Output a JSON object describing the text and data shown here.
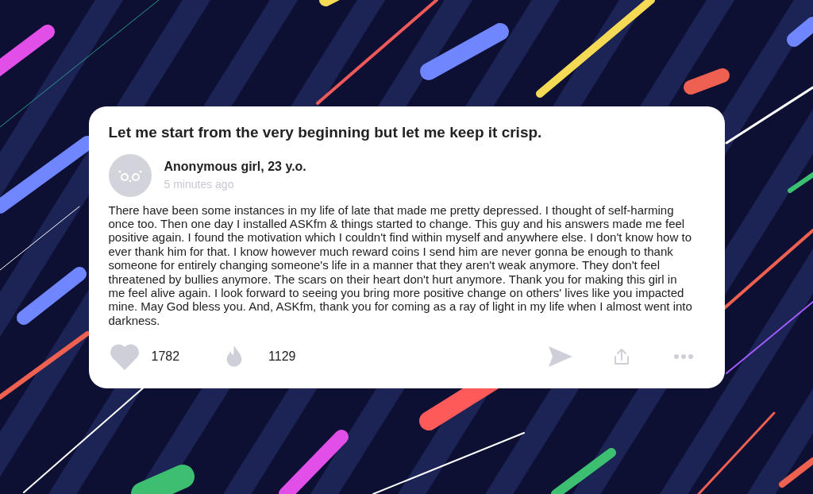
{
  "post": {
    "question": "Let me start from the very beginning but let me keep it crisp.",
    "author": "Anonymous girl, 23 y.o.",
    "time": "5 minutes ago",
    "answer": "There have been some instances in my life of late that made me pretty depressed. I thought of self-harming once too. Then one day I installed ASKfm & things started to change. This guy and his answers made me feel positive again. I found the motivation which I couldn't find within myself and anywhere else. I don't know how to ever thank him for that. I know however much reward coins I send him are never gonna be enough to thank someone for entirely changing someone's life in a manner that they aren't weak anymore. They don't feel threatened by bullies anymore. The scars on their heart don't hurt anymore. Thank you for making this girl in me feel alive again. I look forward to seeing you bring more positive change on others' lives like you impacted mine. May God bless you. And, ASKfm, thank you for coming as a ray of light in my life when I almost went into darkness.",
    "likes": "1782",
    "fires": "1129"
  }
}
